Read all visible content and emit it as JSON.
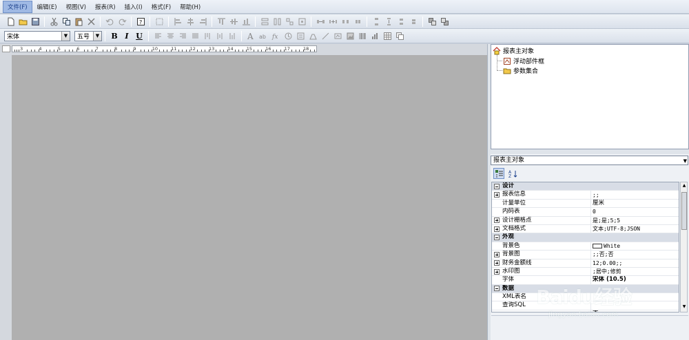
{
  "menu": {
    "items": [
      {
        "label": "文件(F)",
        "active": true
      },
      {
        "label": "编辑(E)"
      },
      {
        "label": "视图(V)"
      },
      {
        "label": "报表(R)"
      },
      {
        "label": "插入(I)"
      },
      {
        "label": "格式(F)"
      },
      {
        "label": "帮助(H)"
      }
    ]
  },
  "format_toolbar": {
    "font_name": "宋体",
    "font_size": "五号",
    "bold": "B",
    "italic": "I",
    "underline": "U"
  },
  "ruler": {
    "labels": [
      "3",
      "4",
      "5",
      "6",
      "7",
      "8",
      "9",
      "10",
      "11",
      "12",
      "13",
      "14",
      "15",
      "16",
      "17",
      "18"
    ]
  },
  "tree": {
    "root": "报表主对象",
    "children": [
      "浮动部件框",
      "参数集合"
    ]
  },
  "properties": {
    "object_selector": "报表主对象",
    "rows": [
      {
        "type": "cat",
        "key": "设计"
      },
      {
        "type": "prop",
        "exp": "plus",
        "key": "报表信息",
        "value": ";;"
      },
      {
        "type": "prop",
        "key": "计量单位",
        "value": "厘米"
      },
      {
        "type": "prop",
        "key": "内码表",
        "value": "0"
      },
      {
        "type": "prop",
        "exp": "plus",
        "key": "设计栅格点",
        "value": "是;是;5;5"
      },
      {
        "type": "prop",
        "exp": "plus",
        "key": "文档格式",
        "value": "文本;UTF-8;JSON"
      },
      {
        "type": "cat",
        "key": "外观"
      },
      {
        "type": "prop",
        "key": "背景色",
        "value": "White",
        "swatch": true
      },
      {
        "type": "prop",
        "exp": "plus",
        "key": "背景图",
        "value": ";;否;否"
      },
      {
        "type": "prop",
        "exp": "plus",
        "key": "财务金额线",
        "value": "12;0.00;;"
      },
      {
        "type": "prop",
        "exp": "plus",
        "key": "水印图",
        "value": ";居中;修剪"
      },
      {
        "type": "prop",
        "key": "字体",
        "value": "宋体 (10.5)",
        "bold": true
      },
      {
        "type": "cat",
        "key": "数据"
      },
      {
        "type": "prop",
        "key": "XML表名",
        "value": ""
      },
      {
        "type": "prop",
        "key": "查询SQL",
        "value": ""
      },
      {
        "type": "prop",
        "key": "......",
        "value": "否"
      }
    ]
  },
  "watermark": {
    "brand": "Baidu经验",
    "url": "jingyan.baidu.com"
  },
  "colors": {
    "canvas": "#b0b0b0",
    "menubar": "#dde4ee",
    "active_menu": "#9fb9e4"
  }
}
